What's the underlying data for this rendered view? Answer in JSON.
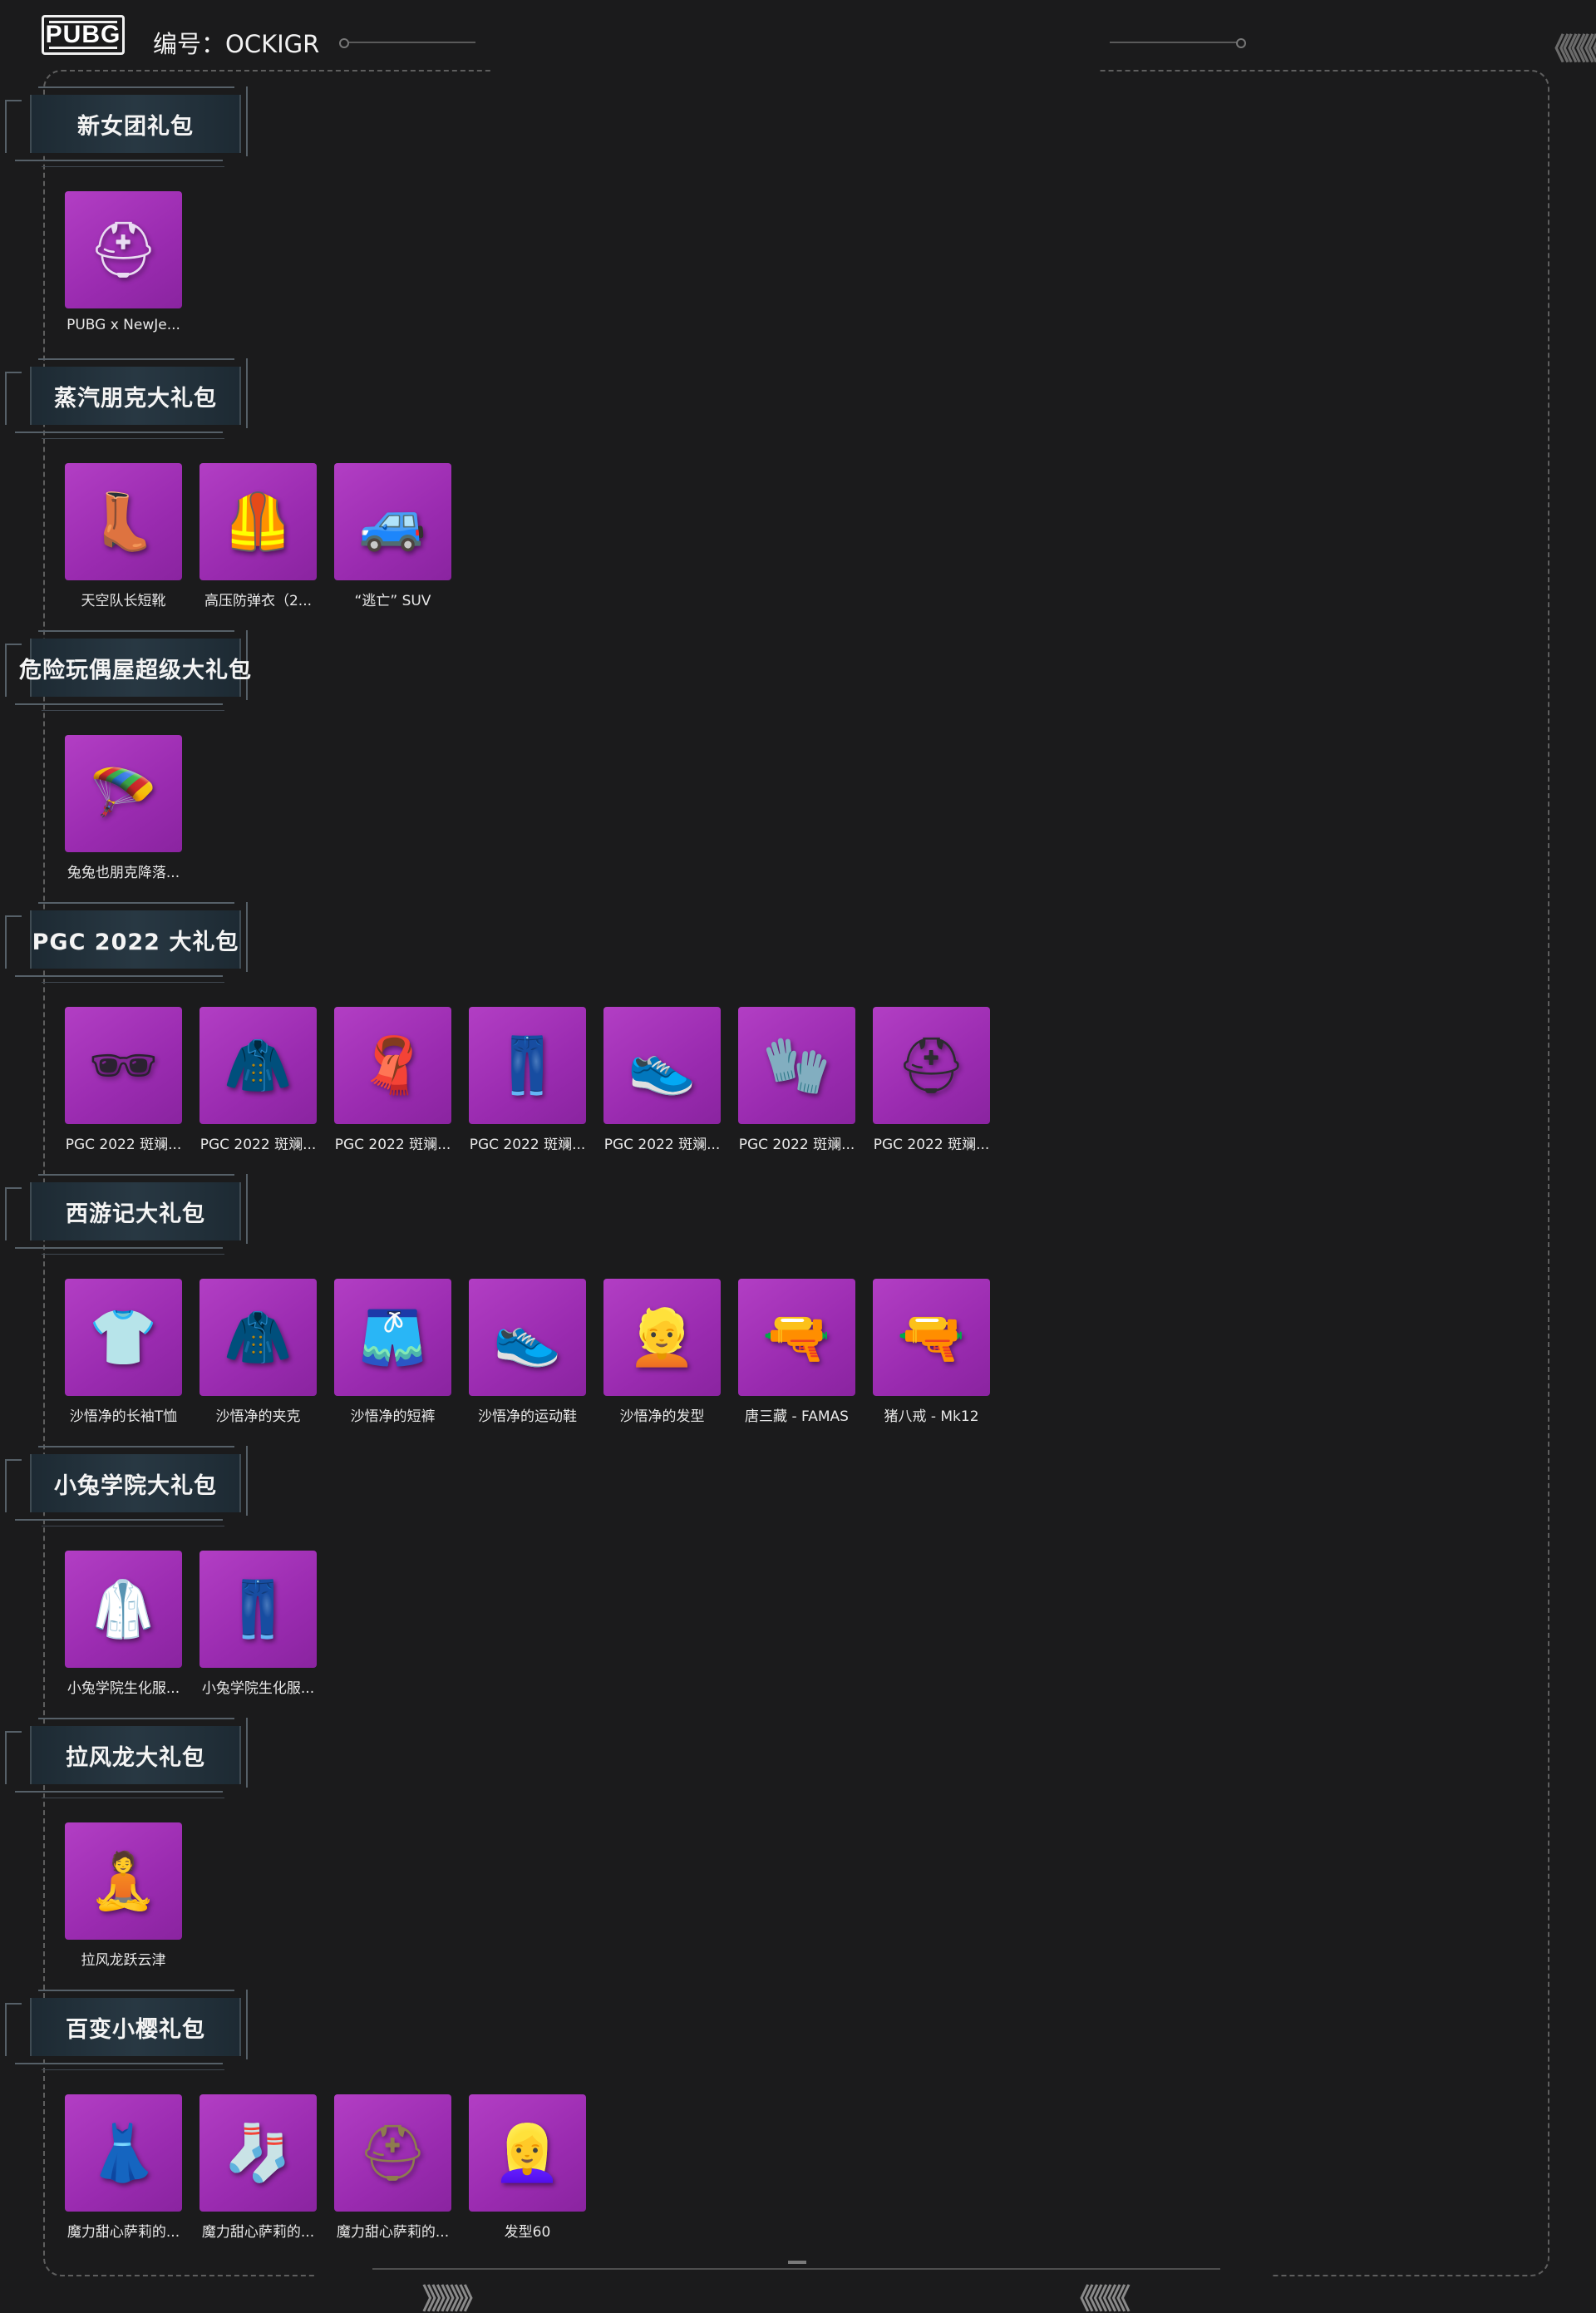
{
  "header": {
    "logo_text": "PUBG",
    "serial": "编号：OCKIGR"
  },
  "nav": {
    "top_right_chevrons": "《《《《《",
    "bottom_left_chevrons": "》》》》》",
    "bottom_right_chevrons": "《《《《《"
  },
  "colors": {
    "background": "#1b1b1c",
    "item_tile": "#a936bd",
    "title_plate": "#253540"
  },
  "sections": [
    {
      "title": "新女团礼包",
      "items": [
        {
          "name": "PUBG x NewJe...",
          "icon": "helmet-icon",
          "glyph": "⛑",
          "tint": "#e9dcf2"
        }
      ]
    },
    {
      "title": "蒸汽朋克大礼包",
      "items": [
        {
          "name": "天空队长短靴",
          "icon": "boots-icon",
          "glyph": "👢",
          "tint": "#3a3a30"
        },
        {
          "name": "高压防弹衣（2...",
          "icon": "vest-icon",
          "glyph": "🦺",
          "tint": "#4a3528"
        },
        {
          "name": "“逃亡” SUV",
          "icon": "car-icon",
          "glyph": "🚙",
          "tint": "#cfc5aa"
        }
      ]
    },
    {
      "title": "危险玩偶屋超级大礼包",
      "items": [
        {
          "name": "兔兔也朋克降落...",
          "icon": "parachute-icon",
          "glyph": "🪂",
          "tint": "#e2a6d8"
        }
      ]
    },
    {
      "title": "PGC 2022 大礼包",
      "items": [
        {
          "name": "PGC 2022 斑斓...",
          "icon": "goggles-icon",
          "glyph": "🕶",
          "tint": "#2a2230"
        },
        {
          "name": "PGC 2022 斑斓...",
          "icon": "jacket-icon",
          "glyph": "🧥",
          "tint": "#222222"
        },
        {
          "name": "PGC 2022 斑斓...",
          "icon": "scarf-icon",
          "glyph": "🧣",
          "tint": "#8fb7d8"
        },
        {
          "name": "PGC 2022 斑斓...",
          "icon": "pants-icon",
          "glyph": "👖",
          "tint": "#1f1f22"
        },
        {
          "name": "PGC 2022 斑斓...",
          "icon": "shoes-icon",
          "glyph": "👟",
          "tint": "#1f1f22"
        },
        {
          "name": "PGC 2022 斑斓...",
          "icon": "gloves-icon",
          "glyph": "🧤",
          "tint": "#1f1f22"
        },
        {
          "name": "PGC 2022 斑斓...",
          "icon": "helmet-icon",
          "glyph": "⛑",
          "tint": "#2c2c30"
        }
      ]
    },
    {
      "title": "西游记大礼包",
      "items": [
        {
          "name": "沙悟净的长袖T恤",
          "icon": "shirt-icon",
          "glyph": "👕",
          "tint": "#a32a22"
        },
        {
          "name": "沙悟净的夹克",
          "icon": "jacket-icon",
          "glyph": "🧥",
          "tint": "#4f7596"
        },
        {
          "name": "沙悟净的短裤",
          "icon": "shorts-icon",
          "glyph": "🩳",
          "tint": "#333333"
        },
        {
          "name": "沙悟净的运动鞋",
          "icon": "sneakers-icon",
          "glyph": "👟",
          "tint": "#2a2a2a"
        },
        {
          "name": "沙悟净的发型",
          "icon": "hair-icon",
          "glyph": "👱",
          "tint": "#c9a26a"
        },
        {
          "name": "唐三藏 - FAMAS",
          "icon": "rifle-icon",
          "glyph": "🔫",
          "tint": "#b39350"
        },
        {
          "name": "猪八戒 - Mk12",
          "icon": "rifle-icon",
          "glyph": "🔫",
          "tint": "#c6a14a"
        }
      ]
    },
    {
      "title": "小兔学院大礼包",
      "items": [
        {
          "name": "小兔学院生化服...",
          "icon": "hazmat-top-icon",
          "glyph": "🥼",
          "tint": "#f2f2f2"
        },
        {
          "name": "小兔学院生化服...",
          "icon": "hazmat-pants-icon",
          "glyph": "👖",
          "tint": "#eeeeee"
        }
      ]
    },
    {
      "title": "拉风龙大礼包",
      "items": [
        {
          "name": "拉风龙跃云津",
          "icon": "meditation-emote-icon",
          "glyph": "🧘",
          "tint": "#ffffff"
        }
      ]
    },
    {
      "title": "百变小樱礼包",
      "items": [
        {
          "name": "魔力甜心萨莉的...",
          "icon": "dress-icon",
          "glyph": "👗",
          "tint": "#3b3a8a"
        },
        {
          "name": "魔力甜心萨莉的...",
          "icon": "stockings-icon",
          "glyph": "🧦",
          "tint": "#c8d6ee"
        },
        {
          "name": "魔力甜心萨莉的...",
          "icon": "helmet-icon",
          "glyph": "⛑",
          "tint": "#8e7c4e"
        },
        {
          "name": "发型60",
          "icon": "hair-icon",
          "glyph": "👱‍♀️",
          "tint": "#e5c98d"
        }
      ]
    }
  ]
}
